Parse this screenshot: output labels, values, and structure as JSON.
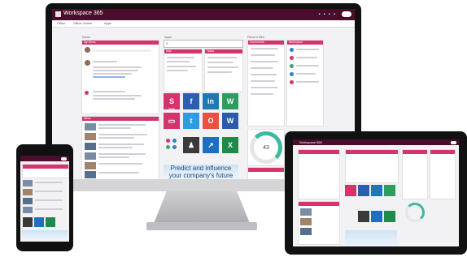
{
  "app": {
    "title": "Workspace 365"
  },
  "subbar": {
    "item1": "Office",
    "item2": "Office Online",
    "item3": "Apps"
  },
  "columns": {
    "news": "News",
    "apps": "Apps",
    "files": "Recent files"
  },
  "cards": {
    "feed": "My News",
    "apps_card": "Workspace",
    "mail": "Mail",
    "tasks": "Tasks",
    "docs": "Documents"
  },
  "tiles": [
    {
      "label": "Stack",
      "color": "#d6336c",
      "glyph": "S"
    },
    {
      "label": "Facebook",
      "color": "#2d5fb0",
      "glyph": "f"
    },
    {
      "label": "LinkedIn",
      "color": "#1e78b4",
      "glyph": "in"
    },
    {
      "label": "WhatsApp",
      "color": "#2e9c5e",
      "glyph": "W"
    },
    {
      "label": "Slides",
      "color": "#d6336c",
      "glyph": "▭"
    },
    {
      "label": "Twitter",
      "color": "#2f9be0",
      "glyph": "t"
    },
    {
      "label": "Office",
      "color": "#e8503f",
      "glyph": "O"
    },
    {
      "label": "Word",
      "color": "#2b5aa8",
      "glyph": "W"
    },
    {
      "label": "Team",
      "color": "#3a3a3a",
      "glyph": "♟"
    },
    {
      "label": "Share",
      "color": "#1f6fc0",
      "glyph": "↗"
    },
    {
      "label": "Excel",
      "color": "#1f8a4c",
      "glyph": "X"
    }
  ],
  "gauge": {
    "value": "43"
  },
  "banner": {
    "line1": "Predict and influence",
    "line2": "your company's future"
  },
  "mini": {
    "title": "Workspace 365"
  }
}
